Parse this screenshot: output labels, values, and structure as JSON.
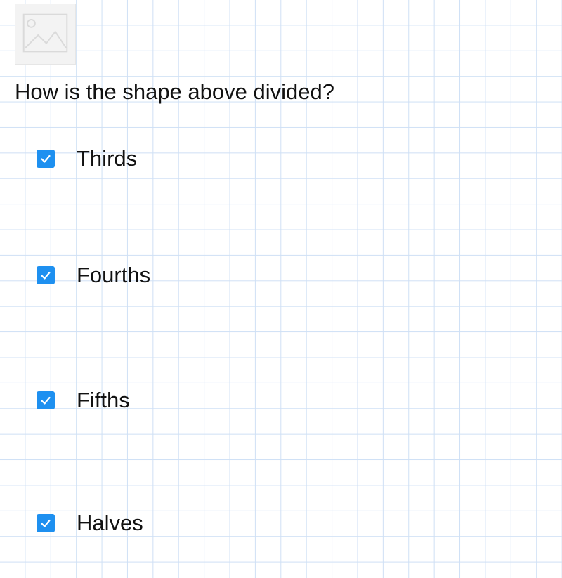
{
  "question": {
    "text": "How is the shape above divided?",
    "image_icon": "image-placeholder-icon"
  },
  "options": [
    {
      "label": "Thirds",
      "checked": true
    },
    {
      "label": "Fourths",
      "checked": true
    },
    {
      "label": "Fifths",
      "checked": true
    },
    {
      "label": "Halves",
      "checked": true
    }
  ],
  "colors": {
    "checkbox": "#1e90f0",
    "grid": "#cfe0f5",
    "text": "#111111"
  }
}
